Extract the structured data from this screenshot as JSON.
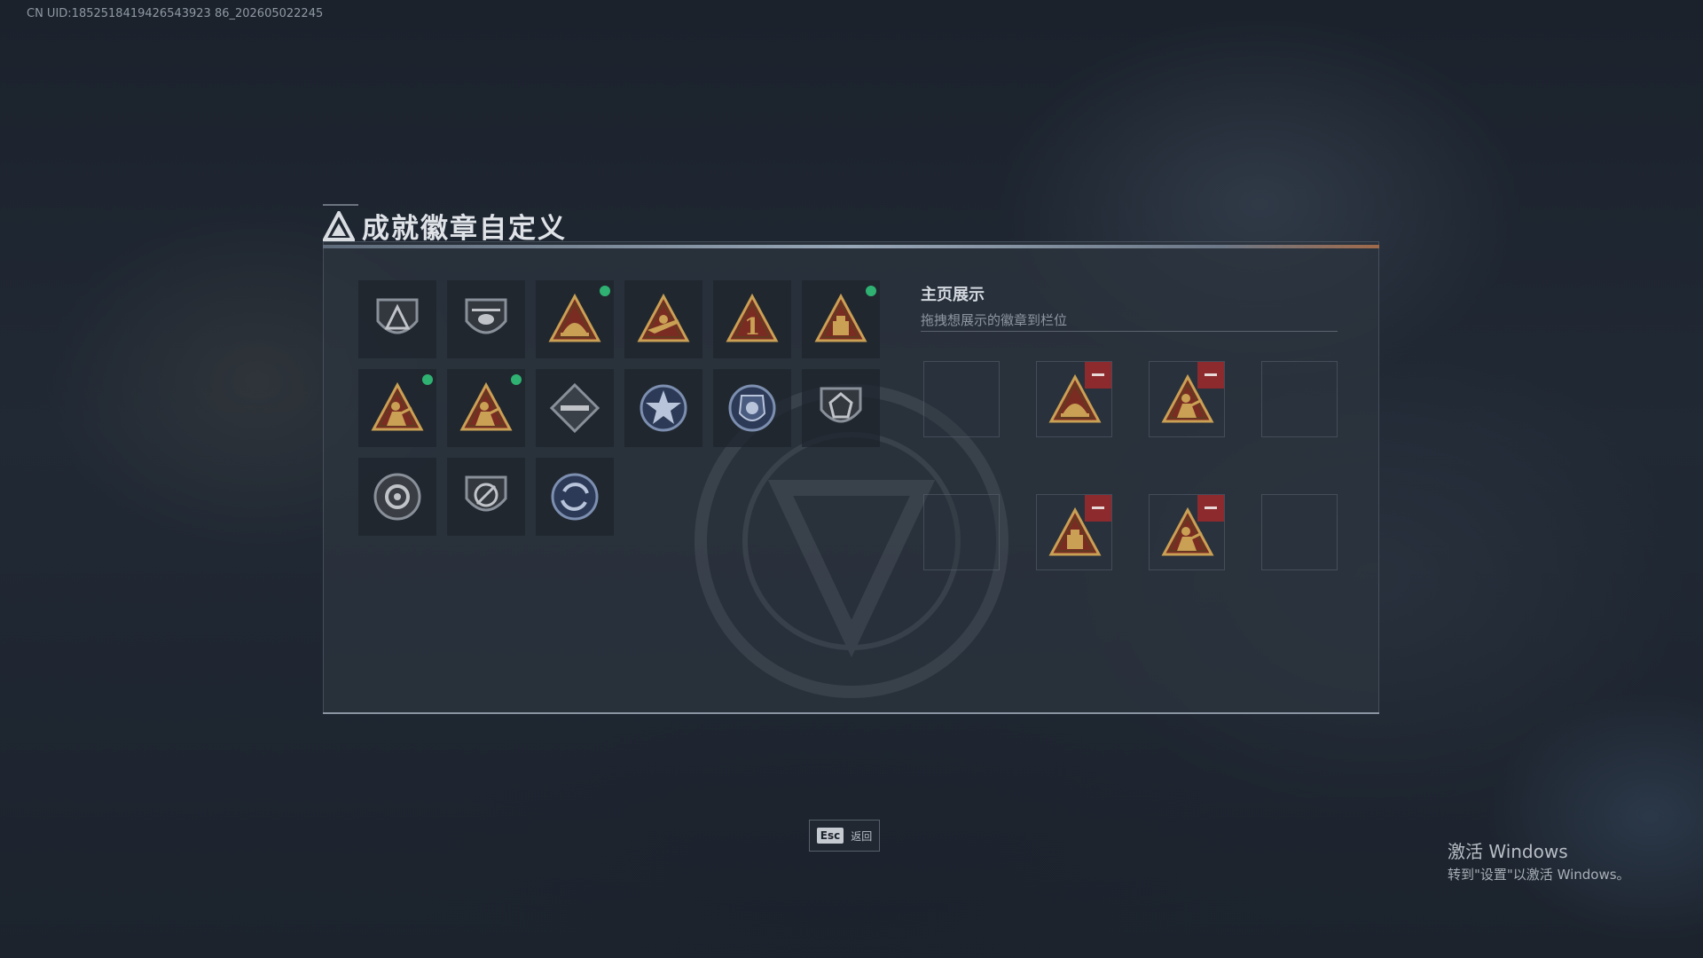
{
  "uid_text": "CN UID:1852518419426543923 86_202605022245",
  "title": "成就徽章自定义",
  "showcase": {
    "title": "主页展示",
    "subtitle": "拖拽想展示的徽章到栏位"
  },
  "badges": [
    {
      "name": "shield-triangle-badge",
      "style": "gray",
      "new": false
    },
    {
      "name": "helicopter-badge",
      "style": "gray",
      "new": false
    },
    {
      "name": "helmet-triangle-badge",
      "style": "gold",
      "new": true
    },
    {
      "name": "rifle-triangle-badge",
      "style": "gold",
      "new": false
    },
    {
      "name": "number-one-triangle-badge",
      "style": "gold",
      "new": false
    },
    {
      "name": "supply-crate-triangle-badge",
      "style": "gold",
      "new": true
    },
    {
      "name": "soldier-triangle-badge",
      "style": "gold",
      "new": true
    },
    {
      "name": "squad-triangle-badge",
      "style": "gold",
      "new": true
    },
    {
      "name": "drone-diamond-badge",
      "style": "gray",
      "new": false
    },
    {
      "name": "star-emblem-badge",
      "style": "blue",
      "new": false
    },
    {
      "name": "police-shield-badge",
      "style": "blue",
      "new": false
    },
    {
      "name": "lion-shield-badge",
      "style": "gray",
      "new": false
    },
    {
      "name": "flower-round-badge",
      "style": "gray",
      "new": false
    },
    {
      "name": "no-gun-shield-badge",
      "style": "gray",
      "new": false
    },
    {
      "name": "recycle-shield-badge",
      "style": "blue",
      "new": false
    }
  ],
  "showcase_slots": [
    {
      "badge": null
    },
    {
      "badge": "helmet-triangle-badge"
    },
    {
      "badge": "squad-triangle-badge"
    },
    {
      "badge": null
    },
    {
      "badge": null
    },
    {
      "badge": "supply-crate-triangle-badge"
    },
    {
      "badge": "soldier-triangle-badge"
    },
    {
      "badge": null
    }
  ],
  "esc": {
    "key": "Esc",
    "label": "返回"
  },
  "windows_activation": {
    "title": "激活 Windows",
    "subtitle": "转到\"设置\"以激活 Windows。"
  },
  "colors": {
    "gold": "#c9a054",
    "gold_dark": "#5a3f20",
    "triangle_red": "#7a2c22",
    "gray": "#8a9099",
    "blue": "#7d8fb0",
    "new_dot": "#2fb172",
    "remove": "#8c2a2e"
  }
}
